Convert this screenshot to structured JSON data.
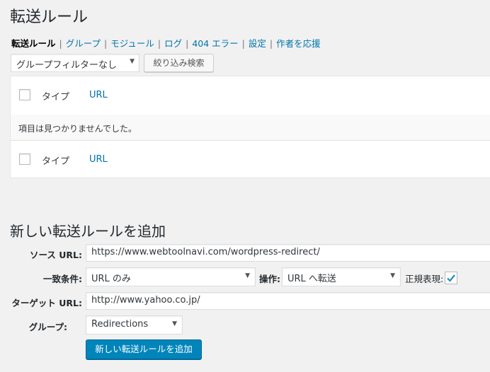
{
  "page": {
    "title": "転送ルール"
  },
  "subnav": {
    "items": [
      {
        "label": "転送ルール",
        "current": true
      },
      {
        "label": "グループ"
      },
      {
        "label": "モジュール"
      },
      {
        "label": "ログ"
      },
      {
        "label": "404 エラー"
      },
      {
        "label": "設定"
      },
      {
        "label": "作者を応援"
      }
    ],
    "separator": "|"
  },
  "filter": {
    "select_value": "グループフィルターなし",
    "button_label": "絞り込み検索"
  },
  "table": {
    "columns": {
      "type": "タイプ",
      "url": "URL"
    },
    "empty_message": "項目は見つかりませんでした。"
  },
  "add_form": {
    "title": "新しい転送ルールを追加",
    "source_label": "ソース URL:",
    "source_value": "https://www.webtoolnavi.com/wordpress-redirect/",
    "match_label": "一致条件:",
    "match_value": "URL のみ",
    "action_label": "操作:",
    "action_value": "URL へ転送",
    "regex_label": "正規表現:",
    "regex_checked": true,
    "target_label": "ターゲット URL:",
    "target_value": "http://www.yahoo.co.jp/",
    "group_label": "グループ:",
    "group_value": "Redirections",
    "submit_label": "新しい転送ルールを追加"
  },
  "colors": {
    "link": "#0073aa",
    "primary_button": "#0085ba",
    "background": "#f1f1f1"
  },
  "icons": {
    "dropdown": "chevron-down-icon",
    "check": "check-icon"
  }
}
